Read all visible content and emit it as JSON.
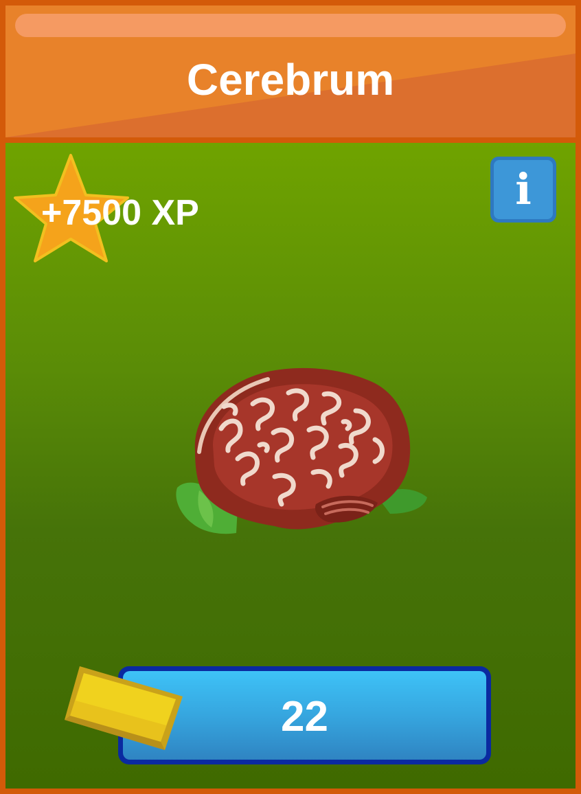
{
  "header": {
    "title": "Cerebrum"
  },
  "reward": {
    "xp_text": "+7500 XP",
    "icon": "star-icon"
  },
  "info": {
    "glyph": "i",
    "icon": "info-icon"
  },
  "item": {
    "icon": "brain-icon"
  },
  "purchase": {
    "price": "22",
    "currency_icon": "gold-bar-icon"
  },
  "colors": {
    "border_orange": "#d35a09",
    "header_orange": "#e8822a",
    "panel_green_top": "#6fa300",
    "panel_green_bottom": "#3f6a00",
    "button_blue": "#36a6df",
    "button_border": "#0a2aa0",
    "star_orange": "#f5a31b",
    "gold": "#e8c21c"
  }
}
